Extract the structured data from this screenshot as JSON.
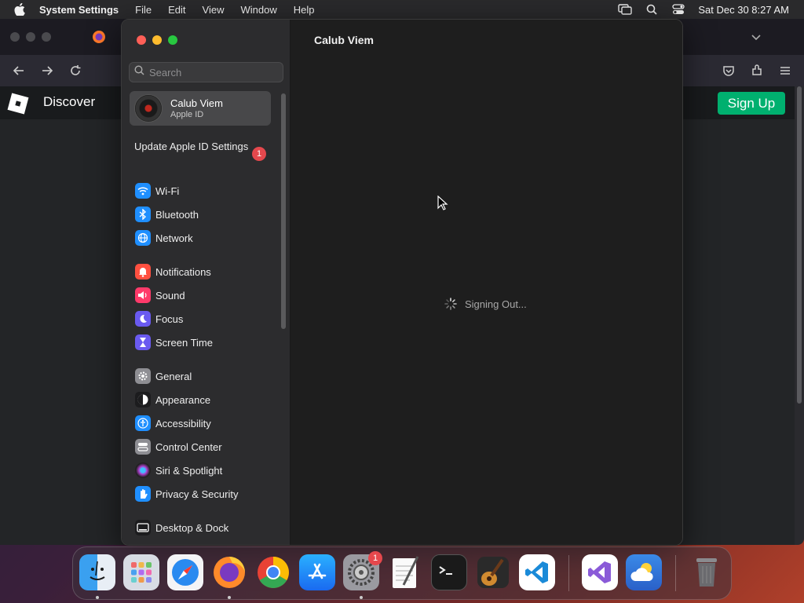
{
  "menubar": {
    "app_name": "System Settings",
    "items": [
      "File",
      "Edit",
      "View",
      "Window",
      "Help"
    ],
    "clock": "Sat Dec 30  8:27 AM"
  },
  "browser": {
    "site_title": "Discover",
    "signup_label": "Sign Up"
  },
  "settings": {
    "search_placeholder": "Search",
    "account": {
      "name": "Calub Viem",
      "subtitle": "Apple ID"
    },
    "update": {
      "label": "Update Apple ID Settings",
      "badge": "1"
    },
    "sidebar_items": [
      {
        "label": "Wi-Fi",
        "icon": "wifi-icon",
        "color": "#1f8fff"
      },
      {
        "label": "Bluetooth",
        "icon": "bluetooth-icon",
        "color": "#1f8fff"
      },
      {
        "label": "Network",
        "icon": "globe-icon",
        "color": "#1f8fff"
      },
      {
        "label": "Notifications",
        "icon": "bell-icon",
        "color": "#ff5040"
      },
      {
        "label": "Sound",
        "icon": "speaker-icon",
        "color": "#ff3a6a"
      },
      {
        "label": "Focus",
        "icon": "moon-icon",
        "color": "#6a5af0"
      },
      {
        "label": "Screen Time",
        "icon": "hourglass-icon",
        "color": "#6a5af0"
      },
      {
        "label": "General",
        "icon": "gear-icon",
        "color": "#8e8e93"
      },
      {
        "label": "Appearance",
        "icon": "appearance-icon",
        "color": "#1c1c1e"
      },
      {
        "label": "Accessibility",
        "icon": "accessibility-icon",
        "color": "#1f8fff"
      },
      {
        "label": "Control Center",
        "icon": "control-center-icon",
        "color": "#8e8e93"
      },
      {
        "label": "Siri & Spotlight",
        "icon": "siri-icon",
        "color": "#b040d0"
      },
      {
        "label": "Privacy & Security",
        "icon": "hand-icon",
        "color": "#1f8fff"
      },
      {
        "label": "Desktop & Dock",
        "icon": "desktop-icon",
        "color": "#1c1c1e"
      }
    ],
    "content_title": "Calub Viem",
    "status_text": "Signing Out..."
  },
  "dock": {
    "settings_badge": "1",
    "apps": [
      "finder-icon",
      "launchpad-icon",
      "safari-icon",
      "firefox-icon",
      "chrome-icon",
      "app-store-icon",
      "system-settings-icon",
      "textedit-icon",
      "terminal-icon",
      "garageband-icon",
      "vscode-icon",
      "visual-studio-icon",
      "weather-icon",
      "trash-icon"
    ]
  }
}
